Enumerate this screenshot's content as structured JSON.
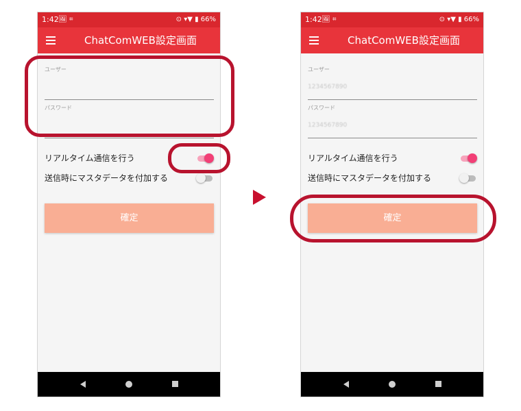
{
  "status_bar": {
    "time": "1:42",
    "left_icons": "🖼 ⌗",
    "right": "⊙ ▾▼ ▮ 66%"
  },
  "app_bar": {
    "title": "ChatComWEB設定画面"
  },
  "screens": {
    "before": {
      "user_label": "ユーザー",
      "user_value": "",
      "password_label": "パスワード",
      "password_value": "",
      "realtime_label": "リアルタイム通信を行う",
      "realtime_on": true,
      "master_label": "送信時にマスタデータを付加する",
      "master_on": false,
      "confirm_label": "確定"
    },
    "after": {
      "user_label": "ユーザー",
      "user_value": "1234567890",
      "password_label": "パスワード",
      "password_value": "1234567890",
      "realtime_label": "リアルタイム通信を行う",
      "realtime_on": true,
      "master_label": "送信時にマスタデータを付加する",
      "master_on": false,
      "confirm_label": "確定"
    }
  },
  "colors": {
    "status_bar": "#d9272e",
    "app_bar": "#e8343b",
    "switch_on": "#f23f76",
    "confirm_button": "#f9ae94",
    "highlight": "#b8132e",
    "arrow": "#c8102e"
  },
  "icons": {
    "menu": "menu-icon",
    "back": "back-icon",
    "home": "home-icon",
    "recent": "recent-apps-icon",
    "arrow": "arrow-right-icon"
  }
}
